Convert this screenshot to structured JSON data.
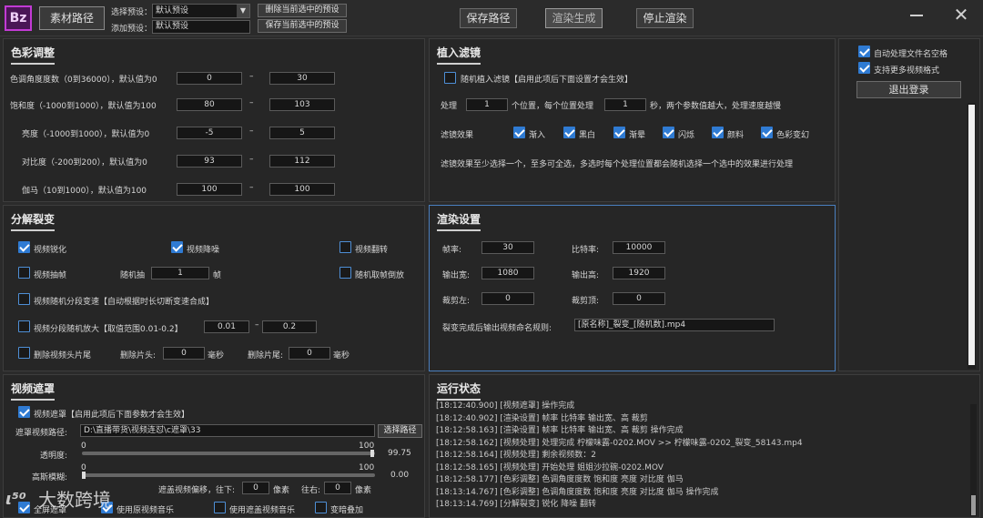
{
  "toolbar": {
    "logo": "Bz",
    "material_path": "素材路径",
    "select_preset_label": "选择预设：",
    "select_preset_value": "默认预设",
    "add_preset_label": "添加预设：",
    "add_preset_value": "默认预设",
    "delete_preset": "删除当前选中的预设",
    "save_preset": "保存当前选中的预设",
    "save_path": "保存路径",
    "render": "渲染生成",
    "stop_render": "停止渲染"
  },
  "color": {
    "title": "色彩调整",
    "rows": [
      {
        "label": "色调角度度数（0到36000），默认值为0",
        "min": "0",
        "max": "30"
      },
      {
        "label": "饱和度（-1000到1000），默认值为100",
        "min": "80",
        "max": "103"
      },
      {
        "label": "亮度（-1000到1000），默认值为0",
        "min": "-5",
        "max": "5"
      },
      {
        "label": "对比度（-200到200），默认值为0",
        "min": "93",
        "max": "112"
      },
      {
        "label": "伽马（10到1000），默认值为100",
        "min": "100",
        "max": "100"
      }
    ],
    "dash": "–"
  },
  "filter": {
    "title": "植入滤镜",
    "random_label": "随机植入滤镜【启用此项后下面设置才会生效】",
    "process_prefix": "处理",
    "positions": "1",
    "process_mid": "个位置，每个位置处理",
    "seconds": "1",
    "process_suffix": "秒，两个参数值越大，处理速度越慢",
    "effects_label": "滤镜效果",
    "effects": [
      "渐入",
      "黑白",
      "渐晕",
      "闪烁",
      "颜料",
      "色彩变幻"
    ],
    "note": "滤镜效果至少选择一个，至多可全选，多选时每个处理位置都会随机选择一个选中的效果进行处理"
  },
  "side": {
    "auto_filename": "自动处理文件名空格",
    "more_formats": "支持更多视频格式",
    "logout": "退出登录"
  },
  "split": {
    "title": "分解裂变",
    "sharpen": "视频锐化",
    "denoise": "视频降噪",
    "flip": "视频翻转",
    "extract_frames": "视频抽帧",
    "random_extract": "随机抽",
    "frames_value": "1",
    "frames_unit": "帧",
    "random_reverse": "随机取帧倒放",
    "random_segment": "视频随机分段变速【自动根据时长切断变速合成】",
    "random_zoom": "视频分段随机放大【取值范围0.01-0.2】",
    "zoom_min": "0.01",
    "zoom_max": "0.2",
    "dash": "–",
    "trim": "删除视频头片尾",
    "trim_head_label": "删除片头:",
    "trim_head": "0",
    "trim_tail_label": "删除片尾:",
    "trim_tail": "0",
    "ms": "毫秒"
  },
  "render_settings": {
    "title": "渲染设置",
    "fps_label": "帧率:",
    "fps": "30",
    "bitrate_label": "比特率:",
    "bitrate": "10000",
    "width_label": "输出宽:",
    "width": "1080",
    "height_label": "输出高:",
    "height": "1920",
    "crop_left_label": "裁剪左:",
    "crop_left": "0",
    "crop_top_label": "裁剪顶:",
    "crop_top": "0",
    "naming_label": "裂变完成后输出视频命名规则:",
    "naming": "[原名称]_裂变_[随机数].mp4"
  },
  "mask": {
    "title": "视频遮罩",
    "enable": "视频遮罩【启用此项后下面参数才会生效】",
    "path_label": "遮罩视频路径:",
    "path": "D:\\直播带货\\视频连怼\\c遮罩\\33",
    "select_path": "选择路径",
    "opacity_label": "透明度:",
    "opacity_min": "0",
    "opacity_max": "100",
    "opacity_value": "99.75",
    "opacity_fraction": 0.9975,
    "blur_label": "高斯模糊:",
    "blur_min": "0",
    "blur_max": "100",
    "blur_value": "0.00",
    "blur_fraction": 0.0,
    "offset_label": "遮盖视频偏移，往下:",
    "offset_down": "0",
    "pixel": "像素",
    "offset_right_label": "往右:",
    "offset_right": "0",
    "fullscreen": "全屏遮罩",
    "original_music": "使用原视频音乐",
    "mask_music": "使用遮盖视频音乐",
    "overlay": "变暗叠加"
  },
  "status": {
    "title": "运行状态",
    "logs": [
      "[18:12:40.900] [视频遮罩] 操作完成",
      "[18:12:40.902] [渲染设置] 帧率 比特率 输出宽、高 裁剪",
      "[18:12:58.163] [渲染设置] 帧率 比特率 输出宽、高 裁剪 操作完成",
      "[18:12:58.162] [视频处理] 处理完成 柠檬味露-0202.MOV >> 柠檬味露-0202_裂变_58143.mp4",
      "[18:12:58.164] [视频处理] 剩余视频数：2",
      "[18:12:58.165] [视频处理] 开始处理 姐姐沙拉碗-0202.MOV",
      "[18:12:58.177] [色彩调整] 色调角度度数 饱和度 亮度 对比度 伽马",
      "[18:13:14.767] [色彩调整] 色调角度度数 饱和度 亮度 对比度 伽马 操作完成",
      "[18:13:14.769] [分解裂变] 锐化 降噪 翻转"
    ]
  },
  "watermark": "大数跨境"
}
